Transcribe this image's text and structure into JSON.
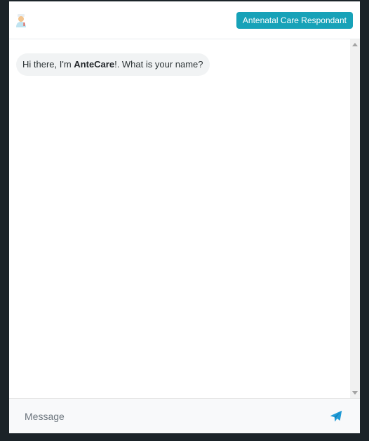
{
  "header": {
    "avatar_icon": "doctor-avatar-icon",
    "role_label": "Antenatal Care Respondant"
  },
  "messages": [
    {
      "sender": "bot",
      "prefix": "Hi there, I'm ",
      "bold": "AnteCare",
      "suffix": "!. What is your name?"
    }
  ],
  "composer": {
    "placeholder": "Message",
    "send_icon": "send-icon"
  },
  "colors": {
    "accent": "#17a2b8",
    "send": "#1e9bd7",
    "bubble": "#f1f3f4",
    "backdrop": "#1b2328"
  }
}
